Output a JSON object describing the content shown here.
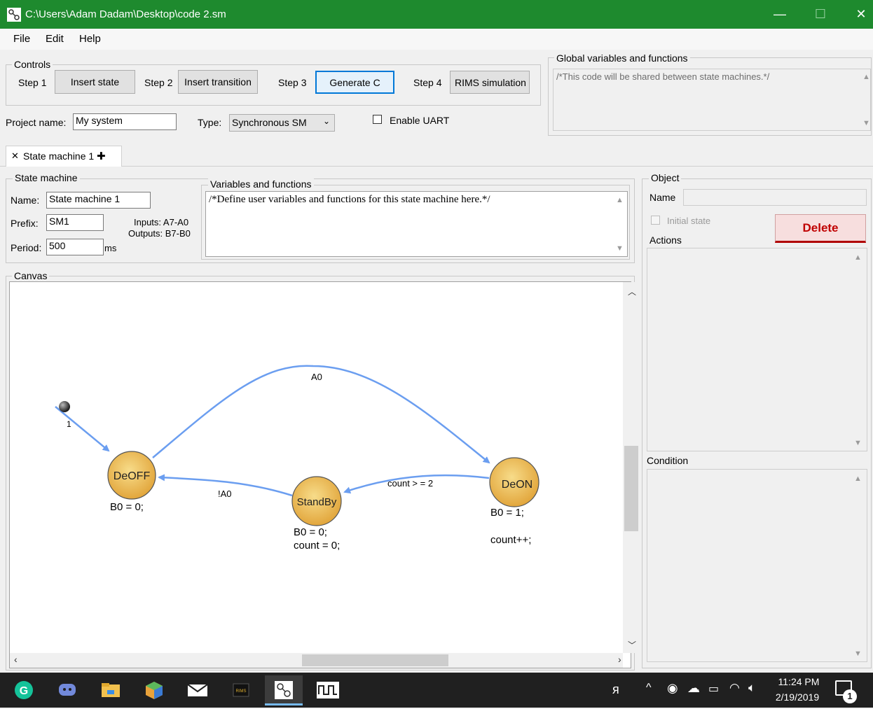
{
  "window": {
    "title": "C:\\Users\\Adam Dadam\\Desktop\\code 2.sm",
    "minimize": "—",
    "maximize": "☐",
    "close": "✕"
  },
  "menu": {
    "file": "File",
    "edit": "Edit",
    "help": "Help"
  },
  "controls": {
    "title": "Controls",
    "step1": "Step 1",
    "insert_state": "Insert state",
    "step2": "Step 2",
    "insert_transition": "Insert transition",
    "step3": "Step 3",
    "generate_c": "Generate C",
    "step4": "Step 4",
    "rims_simulation": "RIMS simulation"
  },
  "global_vars": {
    "title": "Global variables and functions",
    "text": "/*This code will be shared between state machines.*/"
  },
  "project": {
    "name_label": "Project name:",
    "name_value": "My system",
    "type_label": "Type:",
    "type_value": "Synchronous SM",
    "uart_label": "Enable UART"
  },
  "tabs": {
    "tab1": "State machine 1",
    "close_glyph": "✕",
    "add_glyph": "✚"
  },
  "state_machine": {
    "title": "State machine",
    "name_label": "Name:",
    "name_value": "State machine 1",
    "prefix_label": "Prefix:",
    "prefix_value": "SM1",
    "period_label": "Period:",
    "period_value": "500",
    "period_unit": "ms",
    "inputs": "Inputs: A7-A0",
    "outputs": "Outputs: B7-B0"
  },
  "vars_funcs": {
    "title": "Variables and functions",
    "text": "/*Define user variables and functions for this state machine here.*/"
  },
  "object_panel": {
    "title": "Object",
    "name_label": "Name",
    "initial_state": "Initial state",
    "delete": "Delete",
    "actions": "Actions",
    "condition": "Condition"
  },
  "canvas": {
    "title": "Canvas",
    "states": [
      {
        "name": "DeOFF",
        "actions": [
          "B0 = 0;"
        ]
      },
      {
        "name": "StandBy",
        "actions": [
          "B0 = 0;",
          "count = 0;"
        ]
      },
      {
        "name": "DeON",
        "actions": [
          "B0 = 1;",
          "",
          "count++;"
        ]
      }
    ],
    "transitions": [
      {
        "from": "DeOFF",
        "to": "DeON",
        "label": "A0"
      },
      {
        "from": "DeON",
        "to": "StandBy",
        "label": "count > = 2"
      },
      {
        "from": "StandBy",
        "to": "DeOFF",
        "label": "!A0"
      }
    ],
    "initial_label": "1",
    "colors": {
      "state_fill_light": "#f7dc8a",
      "state_fill_dark": "#e2a63c",
      "arrow": "#6b9ef0"
    }
  },
  "taskbar": {
    "time": "11:24 PM",
    "date": "2/19/2019",
    "notification_count": "1",
    "icons": [
      "grammarly-icon",
      "discord-icon",
      "file-explorer-icon",
      "app-cube-icon",
      "mail-icon",
      "rims-icon",
      "state-machine-app-icon",
      "waveform-icon"
    ]
  }
}
